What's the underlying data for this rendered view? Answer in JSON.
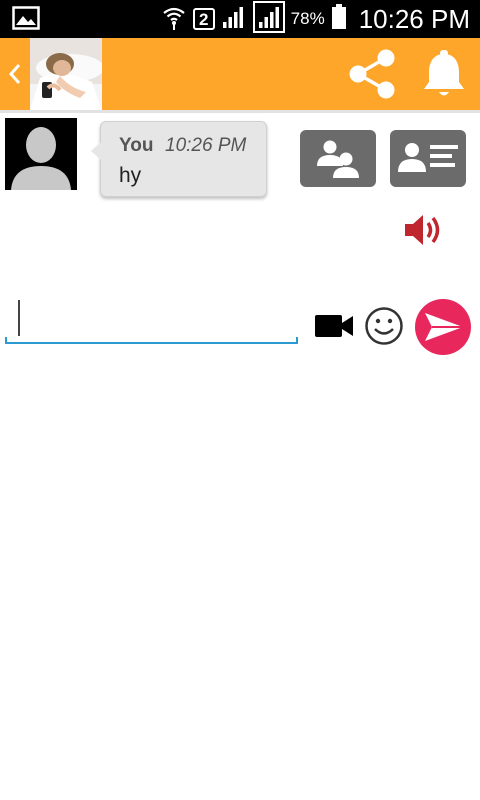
{
  "status_bar": {
    "sim_slot": "2",
    "battery_percent": "78%",
    "time": "10:26 PM",
    "icons": [
      "gallery-notification-icon",
      "wifi-icon",
      "signal-icon",
      "signal-icon",
      "battery-icon"
    ]
  },
  "app_bar": {
    "back_icon": "chevron-left-icon",
    "actions": [
      "share-icon",
      "bell-icon"
    ],
    "color": "#fda62a"
  },
  "conversation": {
    "messages": [
      {
        "sender": "You",
        "time": "10:26 PM",
        "text": "hy"
      }
    ]
  },
  "side_actions": [
    "contacts-icon",
    "contact-card-icon",
    "speaker-icon"
  ],
  "composer": {
    "value": "",
    "placeholder": "",
    "actions": [
      "video-camera-icon",
      "emoji-icon",
      "send-icon"
    ],
    "send_color": "#e8275c",
    "underline_color": "#2a9ad0"
  }
}
